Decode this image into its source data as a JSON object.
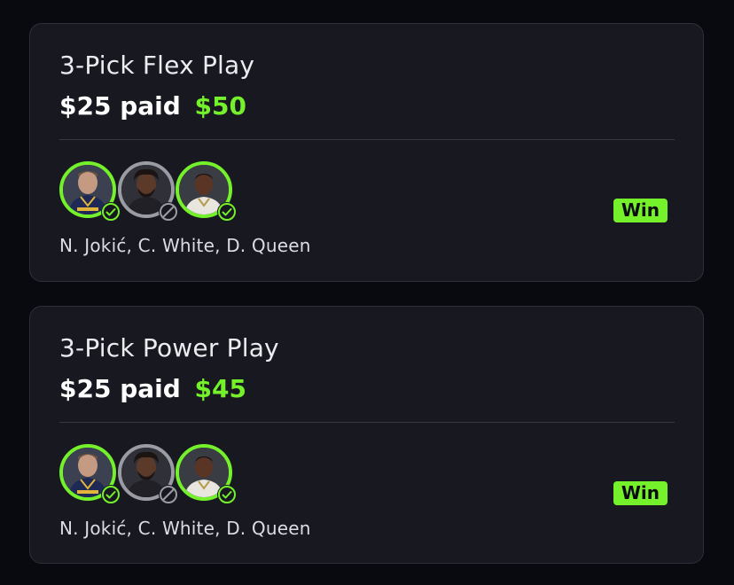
{
  "colors": {
    "background": "#090a10",
    "card": "#171820",
    "accent_green": "#74f12b",
    "void_gray": "#9a9ba3"
  },
  "entries": [
    {
      "title": "3-Pick Flex Play",
      "paid_text": "$25 paid",
      "payout": "$50",
      "players": [
        {
          "name": "N. Jokić",
          "status": "hit",
          "status_icon": "check-circle-icon"
        },
        {
          "name": "C. White",
          "status": "void",
          "status_icon": "void-circle-icon"
        },
        {
          "name": "D. Queen",
          "status": "hit",
          "status_icon": "check-circle-icon"
        }
      ],
      "names_text": "N. Jokić, C. White, D. Queen",
      "result": "Win"
    },
    {
      "title": "3-Pick Power Play",
      "paid_text": "$25 paid",
      "payout": "$45",
      "players": [
        {
          "name": "N. Jokić",
          "status": "hit",
          "status_icon": "check-circle-icon"
        },
        {
          "name": "C. White",
          "status": "void",
          "status_icon": "void-circle-icon"
        },
        {
          "name": "D. Queen",
          "status": "hit",
          "status_icon": "check-circle-icon"
        }
      ],
      "names_text": "N. Jokić, C. White, D. Queen",
      "result": "Win"
    }
  ]
}
